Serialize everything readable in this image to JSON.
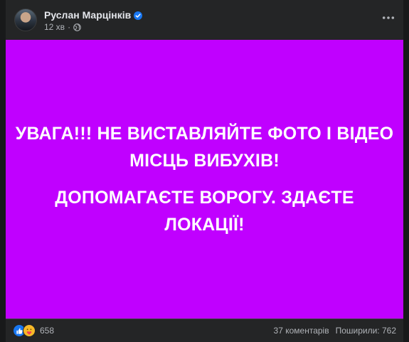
{
  "post": {
    "author": "Руслан Марцінків",
    "time": "12 хв",
    "separator": "·",
    "lines_block1": [
      "УВАГА!!! НЕ ВИСТАВЛЯЙТЕ ФОТО І ВІДЕО",
      "МІСЦЬ ВИБУХІВ!"
    ],
    "lines_block2": [
      "ДОПОМАГАЄТЕ ВОРОГУ. ЗДАЄТЕ",
      "ЛОКАЦІЇ!"
    ],
    "background_color": "#c000ff"
  },
  "footer": {
    "reaction_count": "658",
    "comments": "37 коментарів",
    "shares": "Поширили: 762"
  },
  "icons": {
    "verified": "verified-badge-icon",
    "privacy": "globe-icon",
    "menu": "more-options-icon",
    "reactions": [
      "like-icon",
      "care-icon"
    ]
  }
}
